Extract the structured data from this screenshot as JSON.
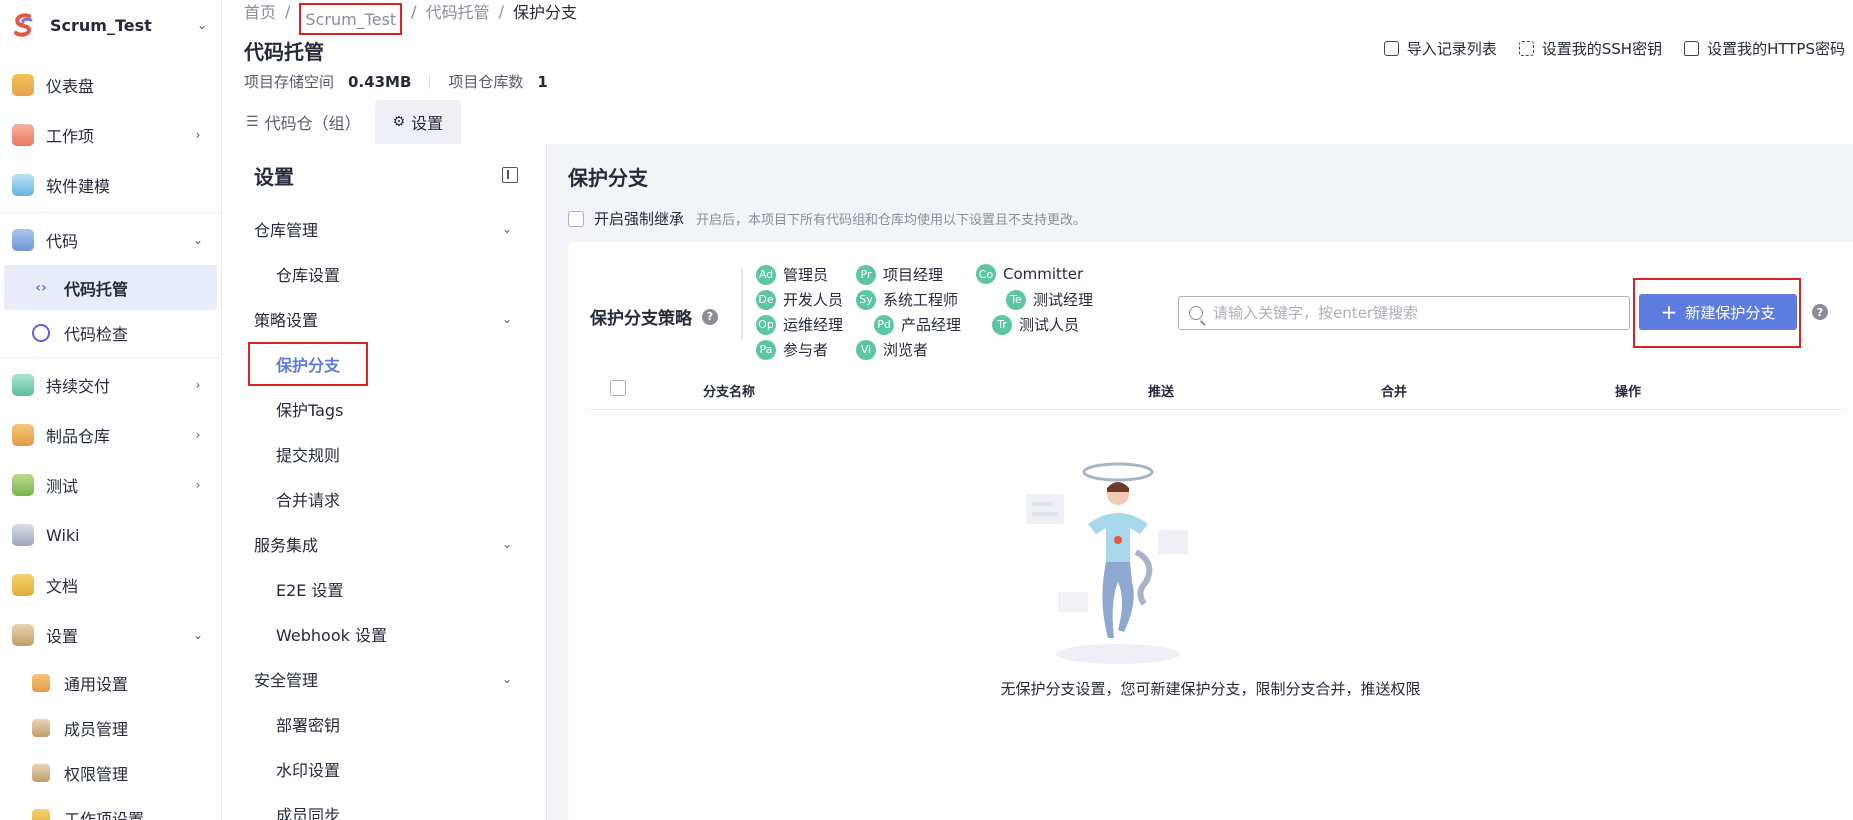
{
  "project": {
    "name": "Scrum_Test"
  },
  "sidebar": {
    "items": [
      {
        "key": "dashboard",
        "label": "仪表盘",
        "icon": "dashboard-icon"
      },
      {
        "key": "workitems",
        "label": "工作项",
        "icon": "workitem-icon"
      },
      {
        "key": "modeling",
        "label": "软件建模",
        "icon": "modeling-icon"
      },
      {
        "key": "code",
        "label": "代码",
        "icon": "code-icon"
      },
      {
        "key": "code-hosting",
        "label": "代码托管",
        "icon": "code-hosting-icon"
      },
      {
        "key": "code-check",
        "label": "代码检查",
        "icon": "code-check-icon"
      },
      {
        "key": "delivery",
        "label": "持续交付",
        "icon": "delivery-icon"
      },
      {
        "key": "artifacts",
        "label": "制品仓库",
        "icon": "artifact-icon"
      },
      {
        "key": "testing",
        "label": "测试",
        "icon": "test-icon"
      },
      {
        "key": "wiki",
        "label": "Wiki",
        "icon": "wiki-icon"
      },
      {
        "key": "docs",
        "label": "文档",
        "icon": "docs-icon"
      },
      {
        "key": "settings",
        "label": "设置",
        "icon": "settings-icon"
      },
      {
        "key": "general",
        "label": "通用设置",
        "icon": "general-settings-icon"
      },
      {
        "key": "members",
        "label": "成员管理",
        "icon": "members-icon"
      },
      {
        "key": "permissions",
        "label": "权限管理",
        "icon": "permissions-icon"
      },
      {
        "key": "workitem-settings",
        "label": "工作项设置",
        "icon": "workitem-settings-icon"
      }
    ]
  },
  "breadcrumb": {
    "home": "首页",
    "project": "Scrum_Test",
    "section": "代码托管",
    "current": "保护分支"
  },
  "header": {
    "title": "代码托管",
    "storage_label": "项目存储空间",
    "storage_value": "0.43MB",
    "repo_count_label": "项目仓库数",
    "repo_count_value": "1",
    "links": {
      "import": "导入记录列表",
      "ssh": "设置我的SSH密钥",
      "https": "设置我的HTTPS密码"
    }
  },
  "tabs": {
    "repos": "代码仓（组）",
    "settings": "设置"
  },
  "settings_nav": {
    "title": "设置",
    "groups": {
      "repo_mgmt": "仓库管理",
      "policy": "策略设置",
      "service": "服务集成",
      "security": "安全管理"
    },
    "items": {
      "repo_settings": "仓库设置",
      "protected_branches": "保护分支",
      "protected_tags": "保护Tags",
      "commit_rules": "提交规则",
      "merge_requests": "合并请求",
      "e2e": "E2E 设置",
      "webhook": "Webhook 设置",
      "deploy_keys": "部署密钥",
      "watermark": "水印设置",
      "member_sync": "成员同步"
    }
  },
  "main": {
    "title": "保护分支",
    "inherit_label": "开启强制继承",
    "inherit_hint": "开启后，本项目下所有代码组和仓库均使用以下设置且不支持更改。",
    "policy_label": "保护分支策略",
    "roles": [
      {
        "abbr": "Ad",
        "name": "管理员"
      },
      {
        "abbr": "Pr",
        "name": "项目经理"
      },
      {
        "abbr": "Co",
        "name": "Committer"
      },
      {
        "abbr": "De",
        "name": "开发人员"
      },
      {
        "abbr": "Sy",
        "name": "系统工程师"
      },
      {
        "abbr": "Te",
        "name": "测试经理"
      },
      {
        "abbr": "Op",
        "name": "运维经理"
      },
      {
        "abbr": "Pd",
        "name": "产品经理"
      },
      {
        "abbr": "Tr",
        "name": "测试人员"
      },
      {
        "abbr": "Pa",
        "name": "参与者"
      },
      {
        "abbr": "Vi",
        "name": "浏览者"
      }
    ],
    "search_placeholder": "请输入关键字，按enter键搜索",
    "new_button": "新建保护分支",
    "columns": {
      "name": "分支名称",
      "push": "推送",
      "merge": "合并",
      "actions": "操作"
    },
    "empty_text": "无保护分支设置，您可新建保护分支，限制分支合并，推送权限"
  },
  "colors": {
    "accent": "#5e7ce0",
    "highlight_box": "#e02020",
    "role_badge": "#5cc6a3"
  }
}
